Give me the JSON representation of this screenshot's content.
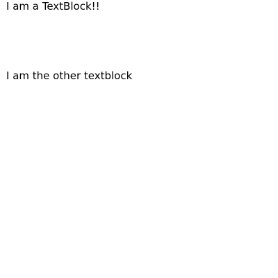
{
  "textblocks": [
    {
      "text": "I am a TextBlock!!"
    },
    {
      "text": "I am the other textblock"
    }
  ],
  "colors": {
    "background": "#ffffff",
    "text": "#000000"
  }
}
